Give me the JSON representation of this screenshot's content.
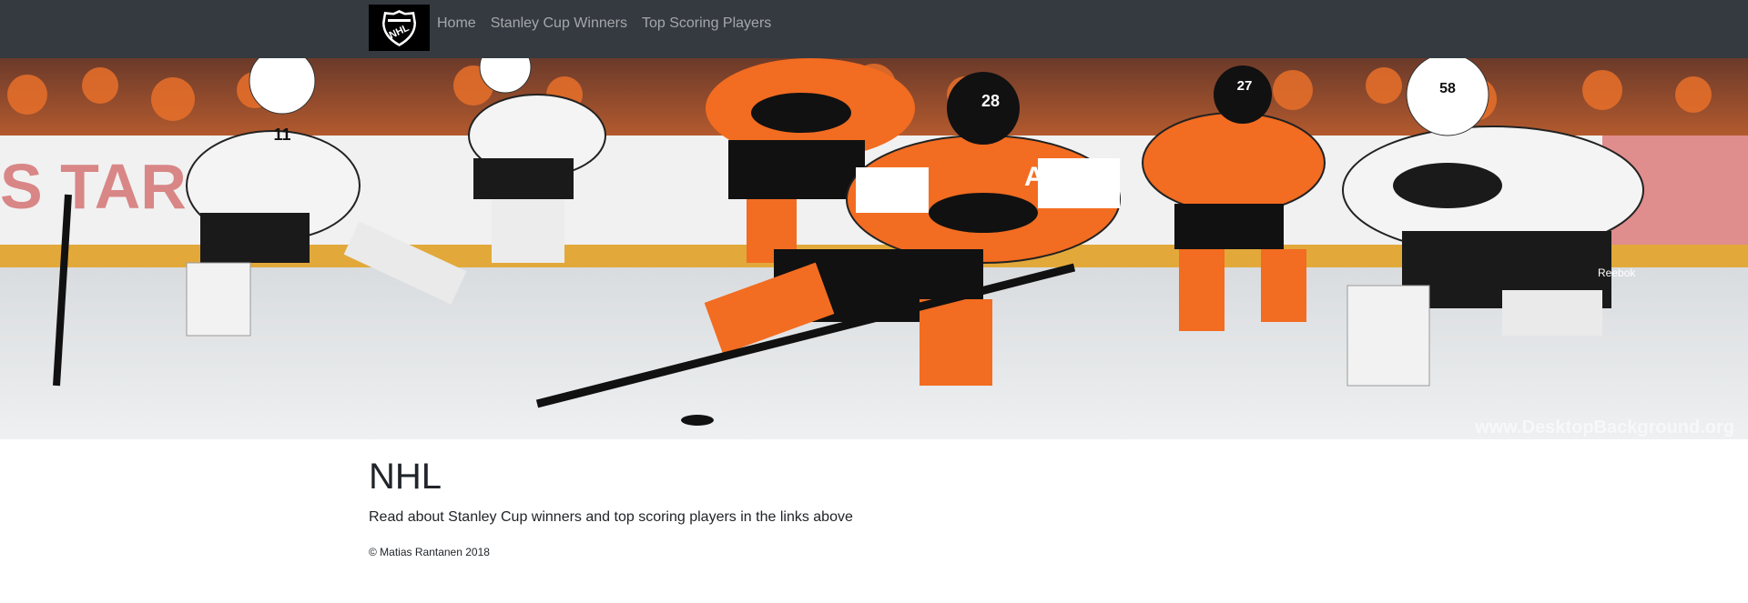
{
  "navbar": {
    "brand_icon": "nhl-shield-logo",
    "links": [
      {
        "label": "Home"
      },
      {
        "label": "Stanley Cup Winners"
      },
      {
        "label": "Top Scoring Players"
      }
    ]
  },
  "hero": {
    "description_icon": "hockey-players-photo",
    "watermark": "www.DesktopBackground.org",
    "jersey_numbers": [
      "11",
      "28",
      "27",
      "58"
    ]
  },
  "main": {
    "title": "NHL",
    "lead": "Read about Stanley Cup winners and top scoring players in the links above"
  },
  "footer": {
    "text": "© Matias Rantanen 2018"
  },
  "colors": {
    "navbar_bg": "#343a40",
    "flyers_orange": "#f26c21",
    "penguins_gold": "#c9b27c"
  }
}
